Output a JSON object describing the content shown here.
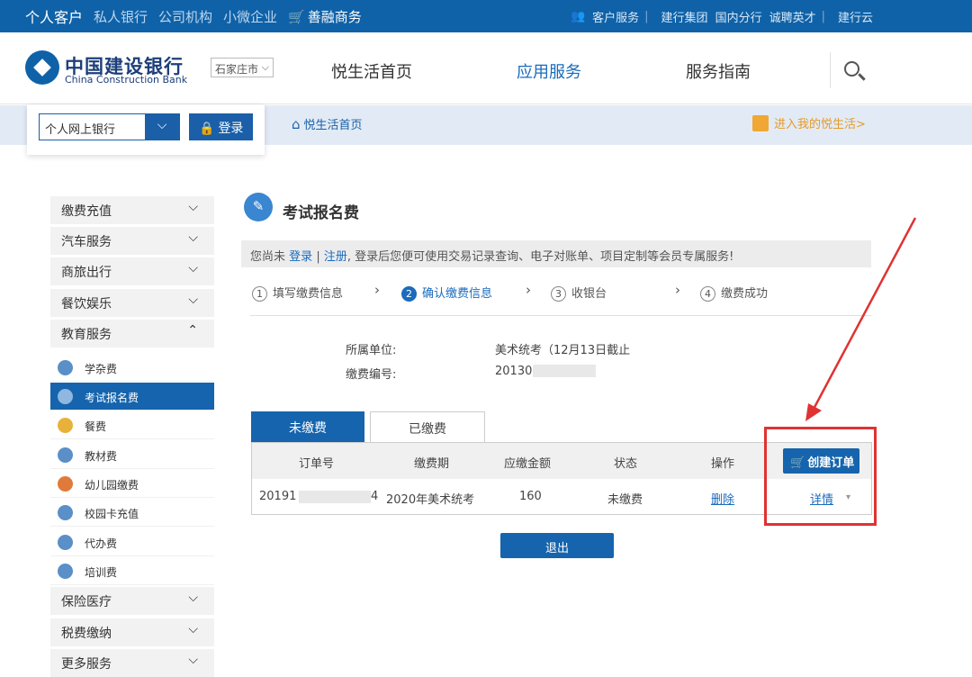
{
  "topbar": {
    "left": [
      "个人客户",
      "私人银行",
      "公司机构",
      "小微企业",
      "善融商务"
    ],
    "right": [
      "客户服务",
      "建行集团",
      "国内分行",
      "诚聘英才",
      "建行云"
    ]
  },
  "header": {
    "bank_cn": "中国建设银行",
    "bank_en": "China Construction Bank",
    "city": "石家庄市",
    "nav": [
      "悦生活首页",
      "应用服务",
      "服务指南"
    ]
  },
  "login": {
    "select_value": "个人网上银行",
    "login_label": "登录"
  },
  "breadcrumb": {
    "home": "悦生活首页",
    "mylife": "进入我的悦生活>"
  },
  "sidebar": {
    "categories": [
      "缴费充值",
      "汽车服务",
      "商旅出行",
      "餐饮娱乐",
      "教育服务",
      "保险医疗",
      "税费缴纳",
      "更多服务"
    ],
    "edu_items": [
      "学杂费",
      "考试报名费",
      "餐费",
      "教材费",
      "幼儿园缴费",
      "校园卡充值",
      "代办费",
      "培训费"
    ]
  },
  "page": {
    "title": "考试报名费",
    "notice_pre": "您尚未",
    "notice_login": "登录",
    "notice_sep": "|",
    "notice_register": "注册",
    "notice_post": ", 登录后您便可使用交易记录查询、电子对账单、项目定制等会员专属服务!"
  },
  "steps": [
    {
      "num": "1",
      "label": "填写缴费信息"
    },
    {
      "num": "2",
      "label": "确认缴费信息"
    },
    {
      "num": "3",
      "label": "收银台"
    },
    {
      "num": "4",
      "label": "缴费成功"
    }
  ],
  "info": {
    "unit_label": "所属单位:",
    "unit_value": "美术统考（12月13日截止",
    "code_label": "缴费编号:",
    "code_value": "20130"
  },
  "tabs": {
    "unpaid": "未缴费",
    "paid": "已缴费"
  },
  "table": {
    "headers": [
      "订单号",
      "缴费期",
      "应缴金额",
      "状态",
      "操作"
    ],
    "create_order": "创建订单",
    "row": {
      "order_prefix": "20191",
      "order_suffix": "4",
      "period": "2020年美术统考",
      "amount": "160",
      "status": "未缴费",
      "delete": "删除",
      "detail": "详情"
    }
  },
  "exit_label": "退出",
  "colors": {
    "primary": "#1564ad",
    "highlight": "#e03232",
    "accent": "#e49a2a"
  }
}
